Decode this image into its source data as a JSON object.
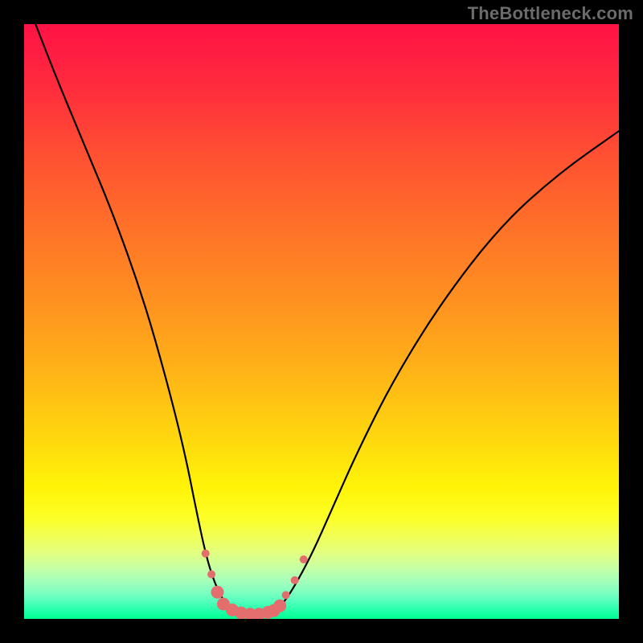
{
  "watermark": "TheBottleneck.com",
  "chart_data": {
    "type": "line",
    "title": "",
    "xlabel": "",
    "ylabel": "",
    "xlim": [
      0,
      100
    ],
    "ylim": [
      0,
      100
    ],
    "series": [
      {
        "name": "curve",
        "x": [
          0,
          5,
          10,
          15,
          20,
          24,
          27,
          29,
          30.5,
          32,
          34,
          36,
          38,
          40,
          42,
          44,
          48,
          52,
          56,
          62,
          70,
          80,
          90,
          100
        ],
        "y": [
          105,
          92,
          80,
          68,
          54,
          40,
          28,
          18,
          11,
          6,
          2.2,
          1.1,
          0.8,
          0.8,
          1.3,
          3,
          10,
          19,
          28,
          40,
          53,
          66,
          75,
          82
        ],
        "color": "#000000"
      }
    ],
    "markers": {
      "color": "#e46e6e",
      "radius_small": 5,
      "radius_large": 8,
      "points": [
        {
          "x": 30.5,
          "y": 11,
          "r": "small"
        },
        {
          "x": 31.5,
          "y": 7.5,
          "r": "small"
        },
        {
          "x": 32.5,
          "y": 4.5,
          "r": "large"
        },
        {
          "x": 33.5,
          "y": 2.5,
          "r": "large"
        },
        {
          "x": 35.0,
          "y": 1.5,
          "r": "large"
        },
        {
          "x": 36.5,
          "y": 1.0,
          "r": "large"
        },
        {
          "x": 38.0,
          "y": 0.8,
          "r": "large"
        },
        {
          "x": 39.5,
          "y": 0.8,
          "r": "large"
        },
        {
          "x": 41.0,
          "y": 1.1,
          "r": "large"
        },
        {
          "x": 42.0,
          "y": 1.4,
          "r": "large"
        },
        {
          "x": 43.0,
          "y": 2.2,
          "r": "large"
        },
        {
          "x": 44.0,
          "y": 4.0,
          "r": "small"
        },
        {
          "x": 45.5,
          "y": 6.5,
          "r": "small"
        },
        {
          "x": 47.0,
          "y": 10.0,
          "r": "small"
        }
      ]
    },
    "background_gradient": {
      "stops": [
        {
          "offset": 0.0,
          "color": "#ff1245"
        },
        {
          "offset": 0.1,
          "color": "#ff2a3e"
        },
        {
          "offset": 0.22,
          "color": "#ff5032"
        },
        {
          "offset": 0.35,
          "color": "#ff7328"
        },
        {
          "offset": 0.48,
          "color": "#ff951f"
        },
        {
          "offset": 0.6,
          "color": "#ffb816"
        },
        {
          "offset": 0.7,
          "color": "#ffd90e"
        },
        {
          "offset": 0.78,
          "color": "#fff408"
        },
        {
          "offset": 0.83,
          "color": "#fcff26"
        },
        {
          "offset": 0.86,
          "color": "#f2ff54"
        },
        {
          "offset": 0.885,
          "color": "#e4ff7a"
        },
        {
          "offset": 0.905,
          "color": "#d2ff97"
        },
        {
          "offset": 0.922,
          "color": "#baffae"
        },
        {
          "offset": 0.94,
          "color": "#9effbc"
        },
        {
          "offset": 0.955,
          "color": "#7effc1"
        },
        {
          "offset": 0.97,
          "color": "#55ffbd"
        },
        {
          "offset": 0.985,
          "color": "#25ffab"
        },
        {
          "offset": 1.0,
          "color": "#00ff93"
        }
      ]
    }
  }
}
